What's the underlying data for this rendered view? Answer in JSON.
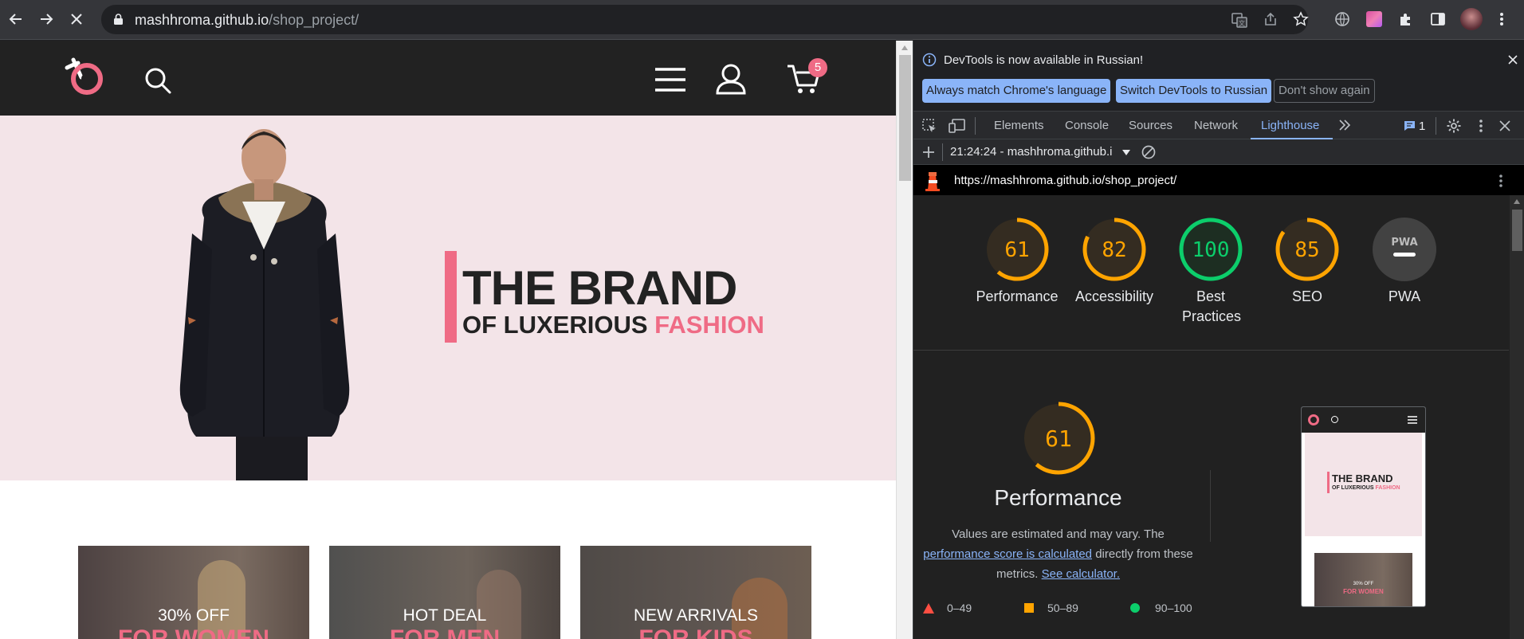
{
  "browser": {
    "url_domain": "mashhroma.github.io",
    "url_path": "/shop_project/",
    "nav_icons": [
      "back-arrow-icon",
      "forward-arrow-icon",
      "stop-loading-icon"
    ],
    "toolbar_icons": [
      "translate-icon",
      "share-icon",
      "bookmark-star-icon",
      "vpn-globe-icon",
      "extension-gradient-icon",
      "puzzle-extensions-icon",
      "side-panel-icon",
      "profile-avatar",
      "menu-kebab-icon"
    ]
  },
  "site": {
    "cart_count": "5",
    "hero": {
      "title": "THE BRAND",
      "subtitle_prefix": "OF LUXERIOUS ",
      "subtitle_highlight": "FASHION"
    },
    "promos": [
      {
        "line1": "30% OFF",
        "line2": "FOR WOMEN"
      },
      {
        "line1": "HOT DEAL",
        "line2": "FOR MEN"
      },
      {
        "line1": "NEW ARRIVALS",
        "line2": "FOR KIDS"
      }
    ],
    "accent_color": "#ef6b85"
  },
  "devtools": {
    "infobar": {
      "message": "DevTools is now available in Russian!",
      "btn_always_match": "Always match Chrome's language",
      "btn_switch": "Switch DevTools to Russian",
      "btn_dont_show": "Don't show again"
    },
    "tabs": [
      "Elements",
      "Console",
      "Sources",
      "Network",
      "Lighthouse"
    ],
    "active_tab": "Lighthouse",
    "issues_count": "1",
    "lighthouse": {
      "report_select": "21:24:24 - mashhroma.github.i",
      "report_url": "https://mashhroma.github.io/shop_project/",
      "scores": [
        {
          "value": "61",
          "label": "Performance",
          "color": "#ffa400"
        },
        {
          "value": "82",
          "label": "Accessibility",
          "color": "#ffa400"
        },
        {
          "value": "100",
          "label": "Best Practices",
          "color": "#0cce6b"
        },
        {
          "value": "85",
          "label": "SEO",
          "color": "#ffa400"
        }
      ],
      "pwa_label": "PWA",
      "pwa_badge": "PWA",
      "performance": {
        "score": "61",
        "title": "Performance",
        "desc_1": "Values are estimated and may vary. The",
        "link_1": "performance score is calculated",
        "desc_2": "directly from these metrics.",
        "link_2": "See calculator."
      },
      "legend": [
        {
          "range": "0–49",
          "shape": "triangle",
          "color": "#ff4e42"
        },
        {
          "range": "50–89",
          "shape": "square",
          "color": "#ffa400"
        },
        {
          "range": "90–100",
          "shape": "circle",
          "color": "#0cce6b"
        }
      ],
      "thumbnail": {
        "title": "THE BRAND",
        "subtitle_prefix": "OF LUXERIOUS ",
        "subtitle_highlight": "FASHION",
        "promo_line1": "30% OFF",
        "promo_line2": "FOR WOMEN"
      }
    }
  }
}
